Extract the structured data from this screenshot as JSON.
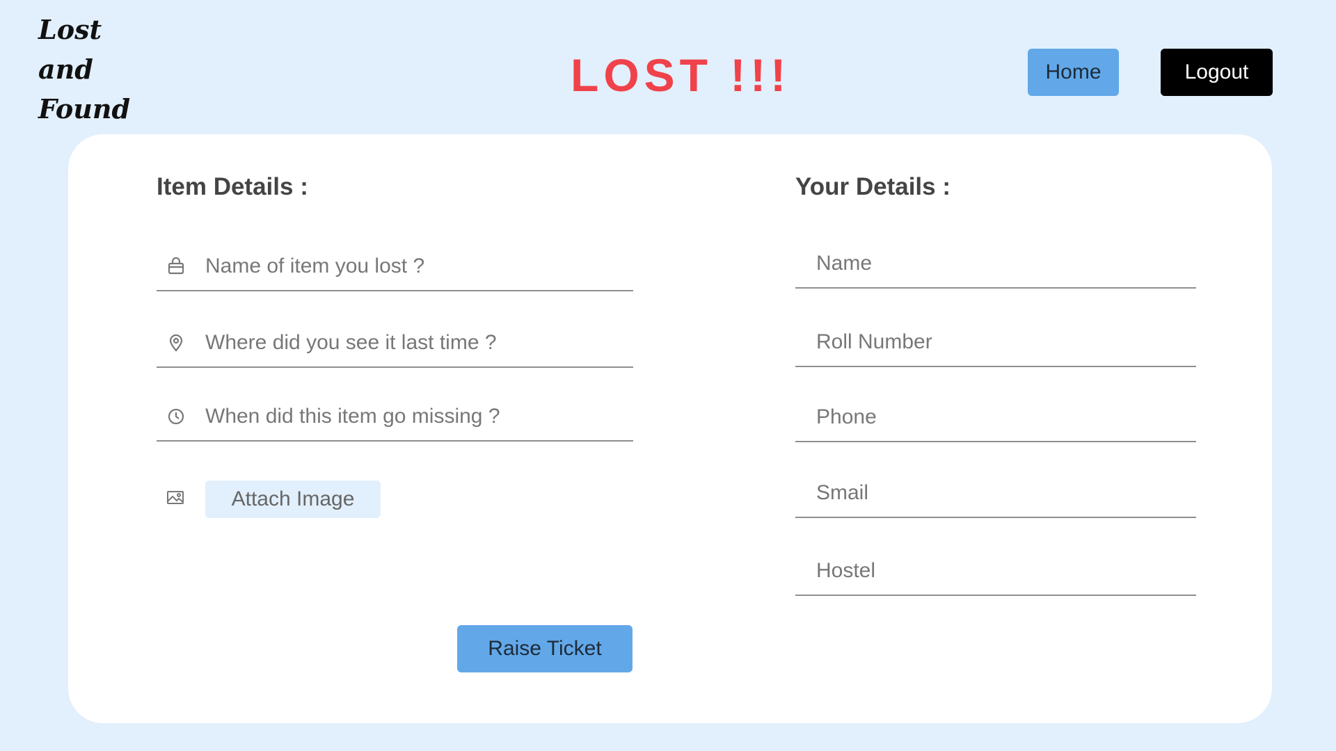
{
  "logo": {
    "line1": "Lost",
    "line2": "and",
    "line3": "Found"
  },
  "header": {
    "title": "LOST !!!"
  },
  "nav": {
    "home_label": "Home",
    "logout_label": "Logout"
  },
  "item_details": {
    "heading": "Item Details :",
    "item_name": {
      "placeholder": "Name of item you lost ?",
      "icon": "bag-icon"
    },
    "location": {
      "placeholder": "Where did you see it last time ?",
      "icon": "location-pin-icon"
    },
    "time": {
      "placeholder": "When did this item go missing ?",
      "icon": "clock-icon"
    },
    "attach_label": "Attach Image",
    "attach_icon": "image-icon"
  },
  "your_details": {
    "heading": "Your Details :",
    "name_placeholder": "Name",
    "roll_placeholder": "Roll Number",
    "phone_placeholder": "Phone",
    "email_placeholder": "Smail",
    "hostel_placeholder": "Hostel"
  },
  "submit_label": "Raise Ticket",
  "colors": {
    "background": "#e2effc",
    "title_red": "#f0424a",
    "primary_blue": "#62a8e8",
    "logout_black": "#000000",
    "card": "#ffffff"
  }
}
